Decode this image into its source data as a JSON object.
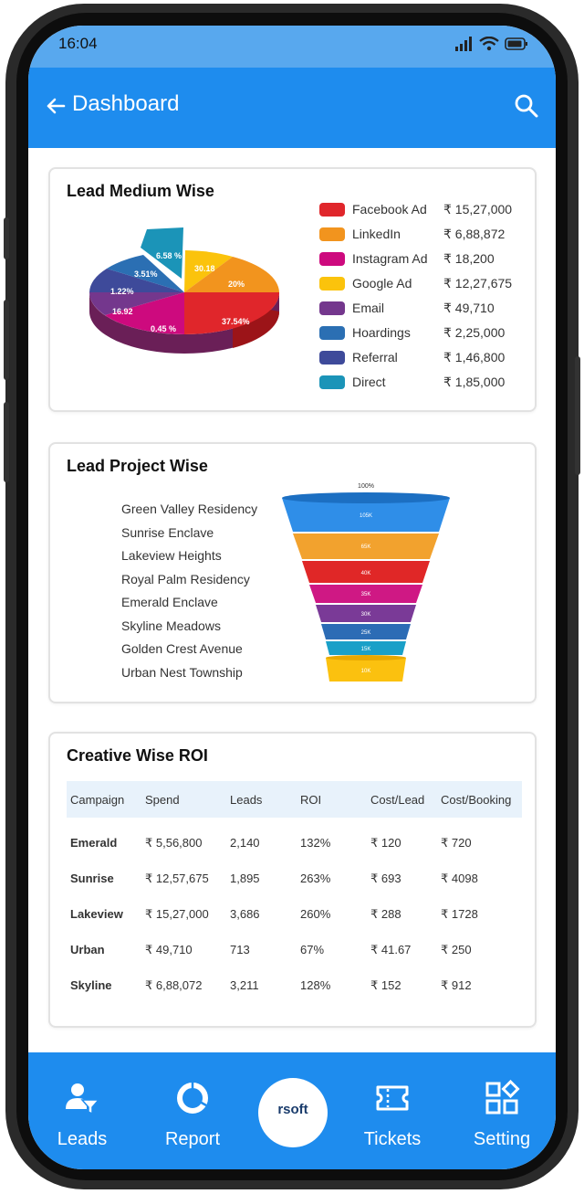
{
  "status_bar": {
    "time": "16:04"
  },
  "app_bar": {
    "title": "Dashboard"
  },
  "lead_medium": {
    "title": "Lead Medium Wise",
    "items": [
      {
        "name": "Facebook Ad",
        "value": "₹ 15,27,000",
        "color": "#e0262b",
        "pct": "37.54%"
      },
      {
        "name": "LinkedIn",
        "value": "₹ 6,88,872",
        "color": "#f2941e",
        "pct": "20%"
      },
      {
        "name": "Instagram Ad",
        "value": "₹ 18,200",
        "color": "#cd0a7e",
        "pct": "0.45 %"
      },
      {
        "name": "Google Ad",
        "value": "₹ 12,27,675",
        "color": "#fbc30c",
        "pct": "30.18"
      },
      {
        "name": "Email",
        "value": "₹ 49,710",
        "color": "#74378d",
        "pct": "16.92"
      },
      {
        "name": "Hoardings",
        "value": "₹ 2,25,000",
        "color": "#2b6fb3",
        "pct": "3.51%"
      },
      {
        "name": "Referral",
        "value": "₹ 1,46,800",
        "color": "#3e4a9a",
        "pct": "1.22%"
      },
      {
        "name": "Direct",
        "value": "₹ 1,85,000",
        "color": "#1b94b8",
        "pct": "6.58 %"
      }
    ]
  },
  "lead_project": {
    "title": "Lead Project Wise",
    "projects": [
      "Green Valley Residency",
      "Sunrise Enclave",
      "Lakeview Heights",
      "Royal Palm Residency",
      "Emerald Enclave",
      "Skyline Meadows",
      "Golden Crest Avenue",
      "Urban Nest Township"
    ],
    "funnel_top_label": "100%",
    "funnel": [
      {
        "label": "105K",
        "color": "#2f8ee8"
      },
      {
        "label": "65K",
        "color": "#f2a22e"
      },
      {
        "label": "40K",
        "color": "#e02727"
      },
      {
        "label": "35K",
        "color": "#cf1884"
      },
      {
        "label": "30K",
        "color": "#7a3a97"
      },
      {
        "label": "25K",
        "color": "#2c6cb5"
      },
      {
        "label": "15K",
        "color": "#1aa0c8"
      },
      {
        "label": "10K",
        "color": "#fbc10f"
      }
    ]
  },
  "roi": {
    "title": "Creative Wise ROI",
    "headers": [
      "Campaign",
      "Spend",
      "Leads",
      "ROI",
      "Cost/Lead",
      "Cost/Booking"
    ],
    "rows": [
      [
        "Emerald",
        "₹ 5,56,800",
        "2,140",
        "132%",
        "₹ 120",
        "₹ 720"
      ],
      [
        "Sunrise",
        "₹ 12,57,675",
        "1,895",
        "263%",
        "₹ 693",
        "₹ 4098"
      ],
      [
        "Lakeview",
        "₹ 15,27,000",
        "3,686",
        "260%",
        "₹ 288",
        "₹ 1728"
      ],
      [
        "Urban",
        "₹ 49,710",
        "713",
        "67%",
        "₹ 41.67",
        "₹ 250"
      ],
      [
        "Skyline",
        "₹ 6,88,072",
        "3,211",
        "128%",
        "₹ 152",
        "₹ 912"
      ]
    ]
  },
  "bottom_nav": {
    "items": [
      {
        "label": "Leads",
        "icon": "user-filter-icon"
      },
      {
        "label": "Report",
        "icon": "donut-chart-icon"
      },
      {
        "label": "Tickets",
        "icon": "ticket-icon"
      },
      {
        "label": "Setting",
        "icon": "grid-settings-icon"
      }
    ],
    "center_brand": "rsoft"
  }
}
